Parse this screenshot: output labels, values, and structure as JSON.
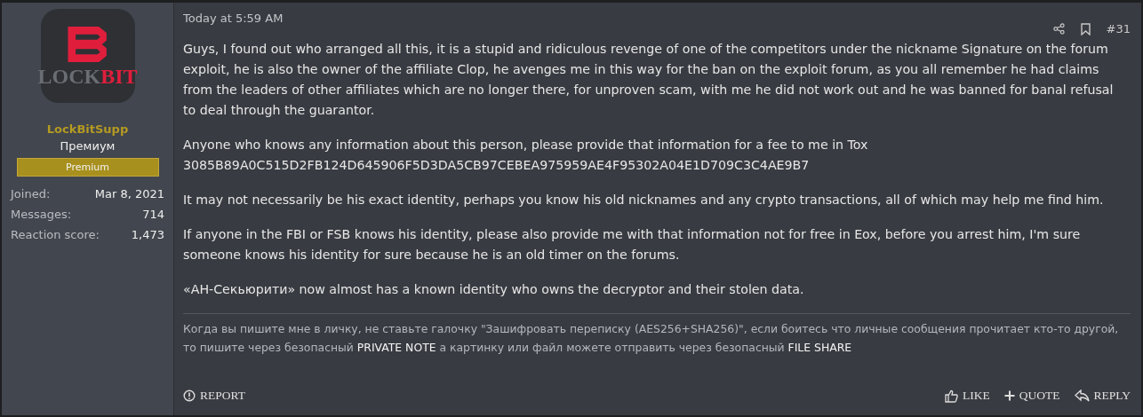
{
  "author": {
    "logo_text": [
      {
        "text": "LOCK",
        "kind": "dim"
      },
      {
        "text": "BIT",
        "kind": "accent"
      }
    ],
    "username": "LockBitSupp",
    "title": "Премиум",
    "banner": "Premium",
    "stats": [
      {
        "label": "Joined:",
        "value": "Mar 8, 2021"
      },
      {
        "label": "Messages:",
        "value": "714"
      },
      {
        "label": "Reaction score:",
        "value": "1,473"
      }
    ]
  },
  "post": {
    "date": "Today at 5:59 AM",
    "number": "#31",
    "paragraphs": [
      {
        "lines": [
          "Guys, I found out who arranged all this, it is a stupid and ridiculous revenge of one of the competitors under the nickname Signature on the forum",
          "exploit, he is also the owner of the affiliate Clop, he avenges me in this way for the ban on the exploit forum, as you all remember he had claims",
          "from the leaders of other affiliates which are no longer there, for unproven scam, with me he did not work out and he was banned for banal refusal",
          "to deal through the guarantor."
        ]
      },
      {
        "lines": [
          "Anyone who knows any information about this person, please provide that information for a fee to me in Tox",
          "3085B89A0C515D2FB124D645906F5D3DA5CB97CEBEA975959AE4F95302A04E1D709C3C4AE9B7"
        ]
      },
      {
        "lines": [
          "It may not necessarily be his exact identity, perhaps you know his old nicknames and any crypto transactions, all of which may help me find him."
        ]
      },
      {
        "lines": [
          "If anyone in the FBI or FSB knows his identity, please also provide me with that information not for free in Eox, before you arrest him, I'm sure",
          "someone knows his identity for sure because he is an old timer on the forums."
        ]
      },
      {
        "lines": [
          "«АН-Секьюрити» now almost has a known identity who owns the decryptor and their stolen data."
        ]
      }
    ],
    "signature": [
      "Когда вы пишите мне в личку, не ставьте галочку \"Зашифровать переписку (AES256+SHA256)\", если боитесь что личные сообщения прочитает кто-то другой,",
      "то пишите через безопасный **PRIVATE NOTE** а картинку или файл можете отправить через безопасный **FILE SHARE**"
    ],
    "report": "REPORT",
    "actions": [
      {
        "kind": "like",
        "label": "LIKE"
      },
      {
        "kind": "quote",
        "label": "QUOTE"
      },
      {
        "kind": "reply",
        "label": "REPLY"
      }
    ]
  }
}
